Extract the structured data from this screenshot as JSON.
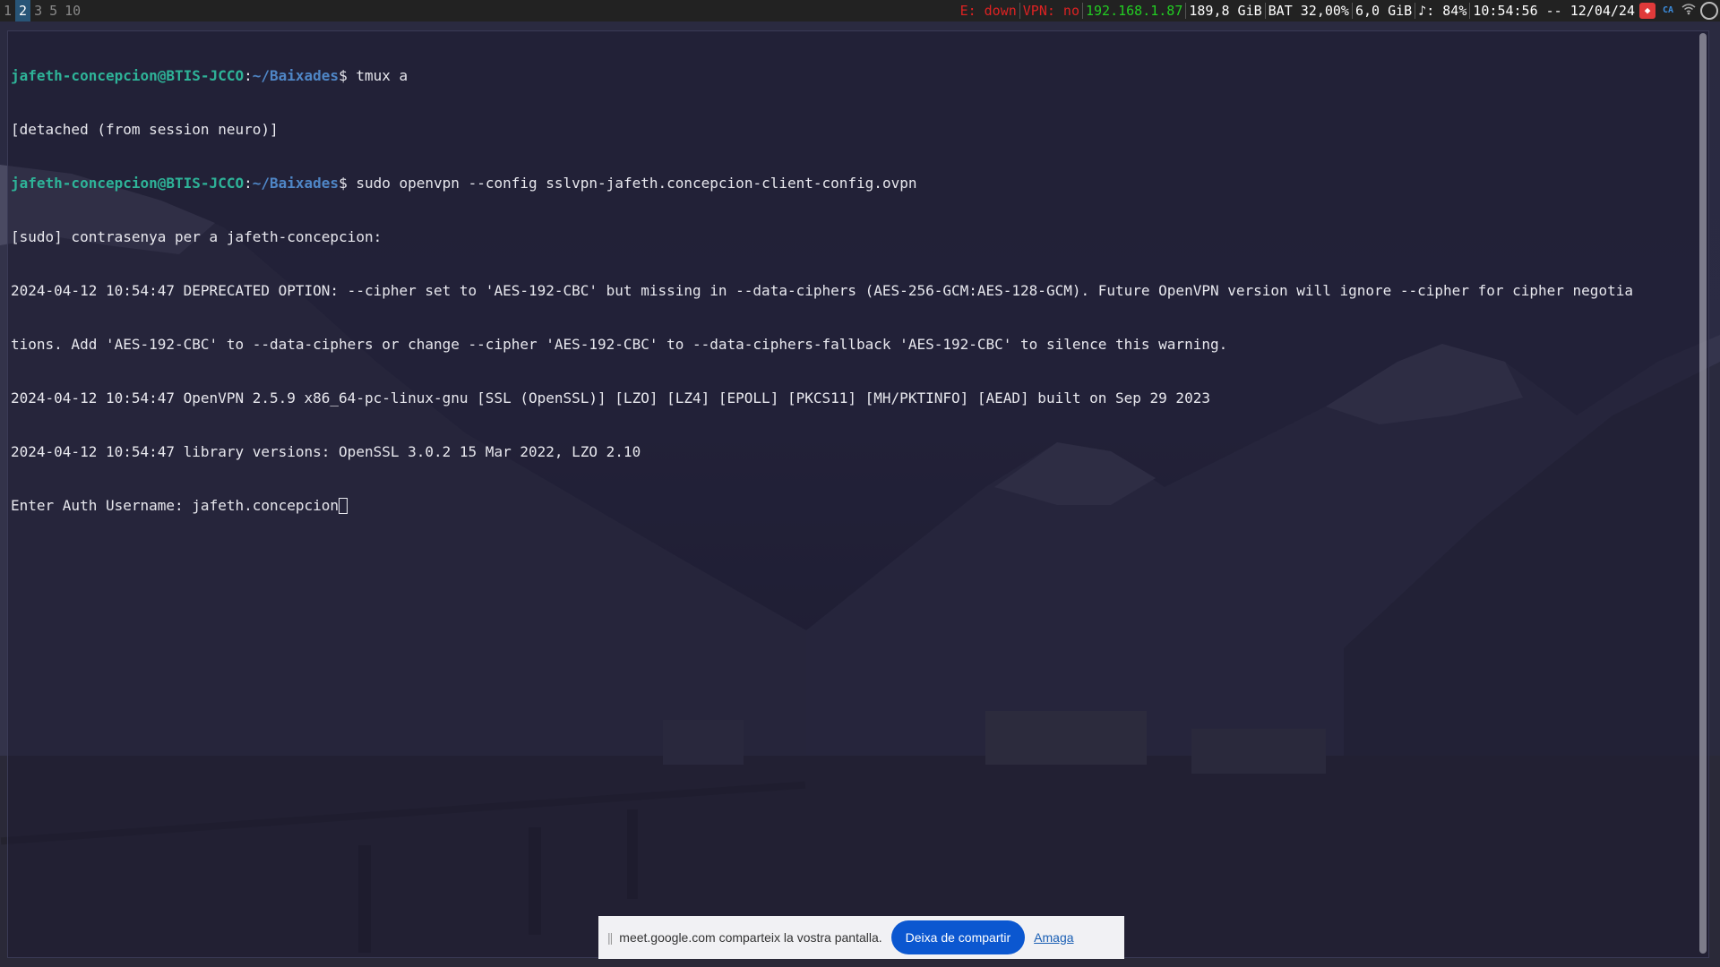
{
  "topbar": {
    "workspaces": [
      {
        "label": "1",
        "active": false
      },
      {
        "label": "2",
        "active": true
      },
      {
        "label": "3",
        "active": false
      },
      {
        "label": "5",
        "active": false
      },
      {
        "label": "10",
        "active": false
      }
    ],
    "status": {
      "ethernet": "E: down",
      "vpn": "VPN: no",
      "ip": "192.168.1.87",
      "disk": "189,8 GiB",
      "battery": "BAT 32,00%",
      "memory": "6,0 GiB",
      "volume": "♪: 84%",
      "datetime": "10:54:56 -- 12/04/24"
    },
    "tray": {
      "lang": "CA",
      "anydesk_icon": "anydesk-icon",
      "wifi_icon": "wifi-icon",
      "globe_icon": "globe-icon"
    },
    "colors": {
      "active_ws": "#285577",
      "red": "#dd2222",
      "green": "#22cc22"
    }
  },
  "terminal": {
    "prompt_user": "jafeth-concepcion@BTIS-JCCO",
    "prompt_sep": ":",
    "prompt_path": "~/Baixades",
    "prompt_symbol": "$",
    "cmd1": " tmux a",
    "line2": "[detached (from session neuro)]",
    "cmd2": " sudo openvpn --config sslvpn-jafeth.concepcion-client-config.ovpn",
    "line4": "[sudo] contrasenya per a jafeth-concepcion:",
    "line5": "2024-04-12 10:54:47 DEPRECATED OPTION: --cipher set to 'AES-192-CBC' but missing in --data-ciphers (AES-256-GCM:AES-128-GCM). Future OpenVPN version will ignore --cipher for cipher negotia",
    "line6": "tions. Add 'AES-192-CBC' to --data-ciphers or change --cipher 'AES-192-CBC' to --data-ciphers-fallback 'AES-192-CBC' to silence this warning.",
    "line7": "2024-04-12 10:54:47 OpenVPN 2.5.9 x86_64-pc-linux-gnu [SSL (OpenSSL)] [LZO] [LZ4] [EPOLL] [PKCS11] [MH/PKTINFO] [AEAD] built on Sep 29 2023",
    "line8": "2024-04-12 10:54:47 library versions: OpenSSL 3.0.2 15 Mar 2022, LZO 2.10",
    "line9_prompt": "Enter Auth Username: ",
    "line9_value": "jafeth.concepcion"
  },
  "share_bar": {
    "grip": "||",
    "message": "meet.google.com comparteix la vostra pantalla.",
    "stop_label": "Deixa de compartir",
    "hide_label": "Amaga"
  }
}
